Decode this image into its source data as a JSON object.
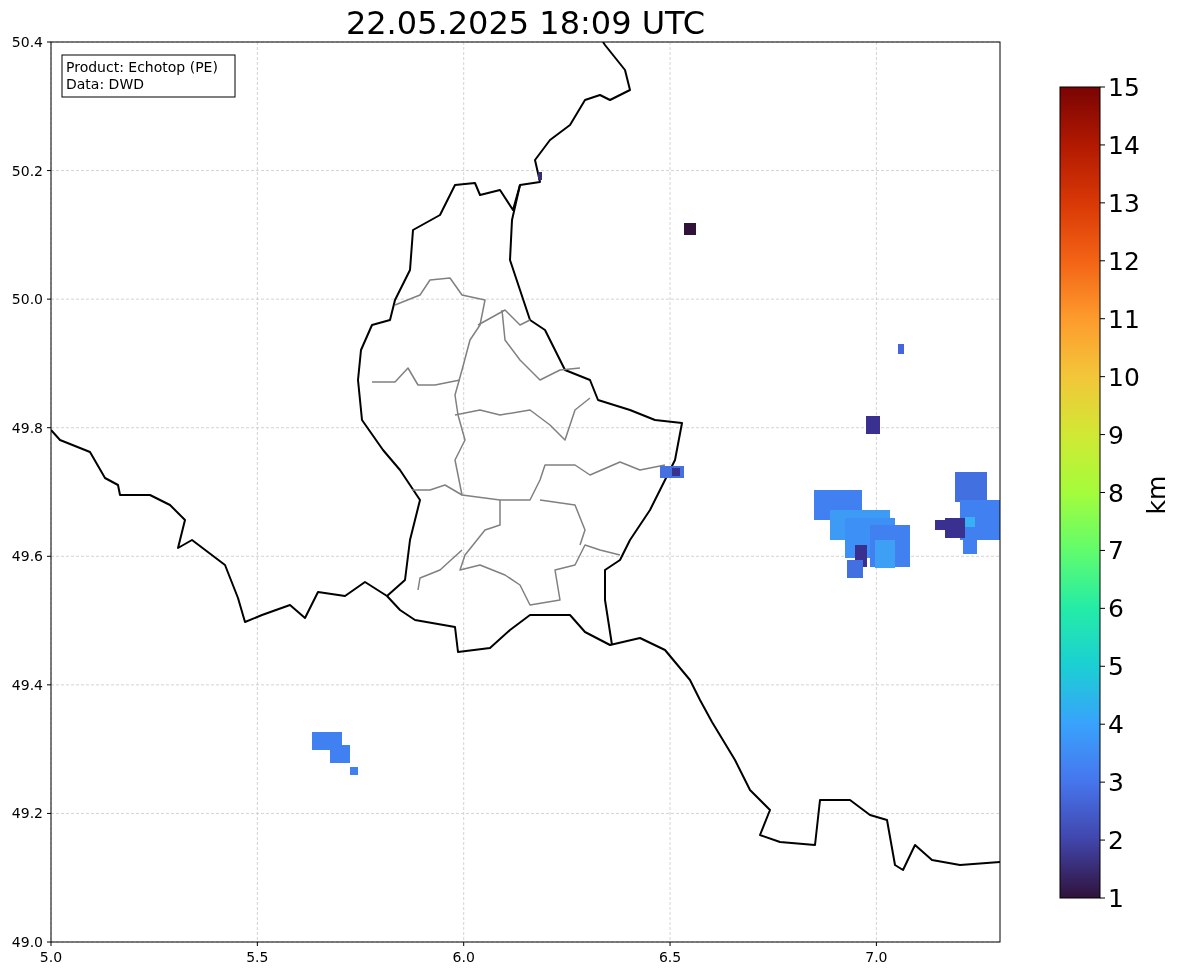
{
  "title": "22.05.2025 18:09 UTC",
  "info_box": {
    "lines": [
      "Product: Echotop (PE)",
      "Data: DWD"
    ]
  },
  "map": {
    "xticks": [
      "5.0",
      "5.5",
      "6.0",
      "6.5",
      "7.0"
    ],
    "yticks": [
      "50.4",
      "50.2",
      "50.0",
      "49.8",
      "49.6",
      "49.4",
      "49.2",
      "49.0"
    ]
  },
  "colorbar": {
    "label": "km",
    "ticks": [
      "15",
      "14",
      "13",
      "12",
      "11",
      "10",
      "9",
      "8",
      "7",
      "6",
      "5",
      "4",
      "3",
      "2",
      "1"
    ]
  }
}
